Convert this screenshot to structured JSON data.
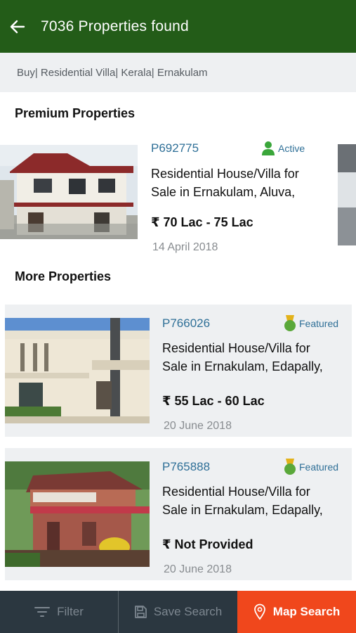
{
  "header": {
    "title": "7036 Properties found"
  },
  "breadcrumb": "Buy| Residential Villa| Kerala| Ernakulam",
  "sections": {
    "premium": "Premium Properties",
    "more": "More Properties"
  },
  "premium": {
    "code": "P692775",
    "status": "Active",
    "title_line1": "Residential House/Villa for",
    "title_line2": "Sale in Ernakulam, Aluva,",
    "price": "₹ 70 Lac - 75 Lac",
    "date": "14 April 2018"
  },
  "listings": [
    {
      "code": "P766026",
      "badge": "Featured",
      "title_line1": "Residential House/Villa for",
      "title_line2": "Sale in Ernakulam, Edapally,",
      "price": "₹ 55 Lac - 60 Lac",
      "date": "20 June 2018"
    },
    {
      "code": "P765888",
      "badge": "Featured",
      "title_line1": "Residential House/Villa for",
      "title_line2": "Sale in Ernakulam, Edapally,",
      "price": "₹ Not Provided",
      "date": "20 June 2018"
    }
  ],
  "bottom_bar": {
    "filter": "Filter",
    "save_search": "Save Search",
    "map_search": "Map Search"
  },
  "colors": {
    "header": "#235c18",
    "accent_link": "#2e6f97",
    "map_button": "#f0471c",
    "bottom_bar": "#2b3740"
  }
}
